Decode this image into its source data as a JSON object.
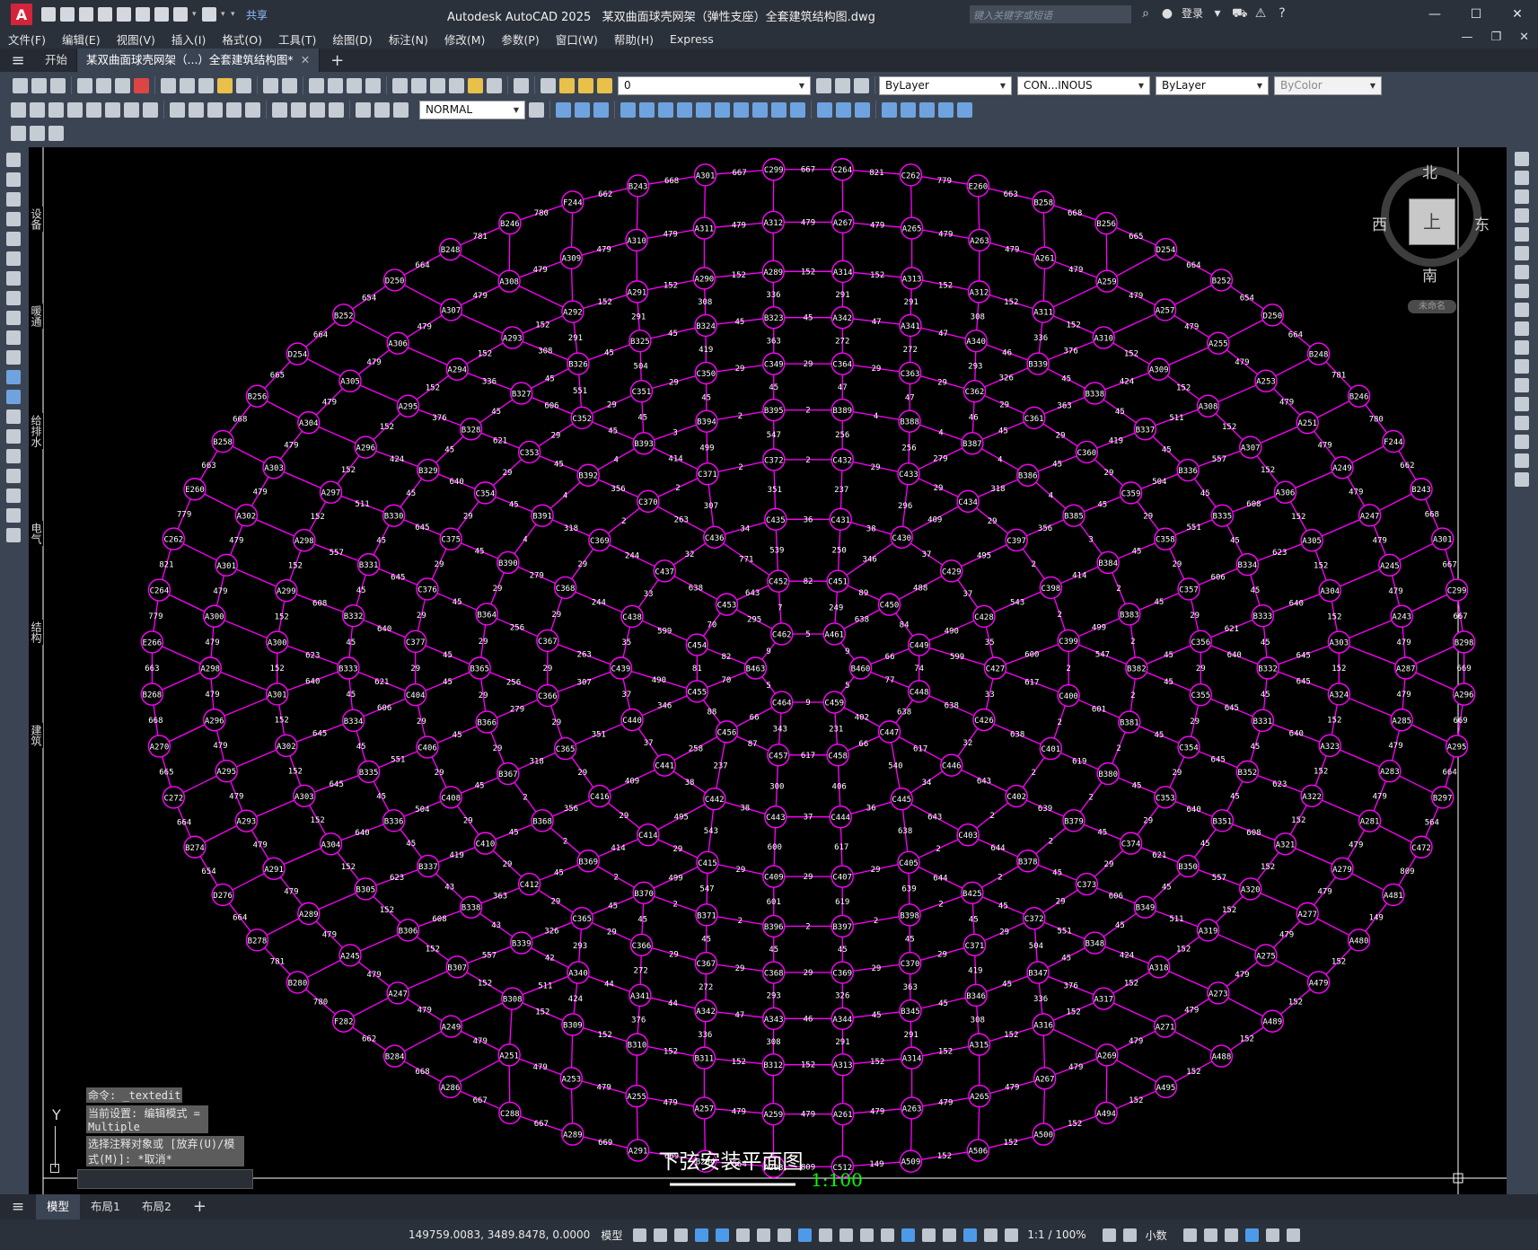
{
  "app": {
    "title": "Autodesk AutoCAD 2025",
    "document": "某双曲面球壳网架（弹性支座）全套建筑结构图.dwg",
    "share": "共享",
    "search_placeholder": "键入关键字或短语",
    "login": "登录"
  },
  "menu": [
    "文件(F)",
    "编辑(E)",
    "视图(V)",
    "插入(I)",
    "格式(O)",
    "工具(T)",
    "绘图(D)",
    "标注(N)",
    "修改(M)",
    "参数(P)",
    "窗口(W)",
    "帮助(H)",
    "Express"
  ],
  "doc_tabs": {
    "start": "开始",
    "active": "某双曲面球壳网架（...）全套建筑结构图*"
  },
  "toolbar": {
    "layer": "0",
    "text_style": "NORMAL",
    "color": "ByLayer",
    "linetype": "CON...INOUS",
    "lineweight": "ByLayer",
    "plotstyle": "ByColor"
  },
  "viewcube": {
    "north": "北",
    "south": "南",
    "east": "东",
    "west": "西",
    "top": "上",
    "wcs": "未命名"
  },
  "side_labels": [
    "设备",
    "暖通",
    "给排水",
    "电气",
    "结构",
    "建筑"
  ],
  "command": {
    "line1": "命令: _textedit",
    "line2": "当前设置: 编辑模式 = Multiple",
    "line3": "选择注释对象或 [放弃(U)/模式(M)]: *取消*"
  },
  "drawing": {
    "title": "下弦安装平面图",
    "scale": "1:100"
  },
  "layout_tabs": [
    "模型",
    "布局1",
    "布局2"
  ],
  "status": {
    "coords": "149759.0083, 3489.8478, 0.0000",
    "space": "模型",
    "annoscale": "1:1 / 100%",
    "units": "小数"
  },
  "colors": {
    "grid_line": "#ff00ff",
    "node_label": "#ffffff",
    "background": "#000000",
    "scale_text": "#00ff00"
  },
  "rings": [
    {
      "id": "ring-1",
      "rx": 80,
      "ry": 60,
      "n": 6,
      "labels": [
        "A461",
        "B460",
        "C459",
        "C464",
        "B463",
        "C462"
      ],
      "seg": [
        "9",
        "5",
        "9",
        "5",
        "9",
        "5"
      ],
      "rad": []
    },
    {
      "id": "ring-2",
      "rx": 175,
      "ry": 137,
      "n": 12,
      "labels": [
        "C451",
        "C450",
        "C449",
        "C448",
        "C447",
        "C458",
        "C457",
        "C456",
        "C455",
        "C454",
        "C453",
        "C452"
      ],
      "seg": [
        "89",
        "84",
        "74",
        "638",
        "66",
        "617",
        "87",
        "88",
        "81",
        "70",
        "643",
        "82"
      ],
      "rad": [
        "249",
        "638",
        "66",
        "77",
        "402",
        "231",
        "343",
        "66",
        "70",
        "82",
        "295",
        "7"
      ]
    },
    {
      "id": "ring-3",
      "rx": 285,
      "ry": 230,
      "n": 18,
      "labels": [
        "C431",
        "C430",
        "C429",
        "C428",
        "C427",
        "C426",
        "C446",
        "C445",
        "C444",
        "C443",
        "C442",
        "C441",
        "C440",
        "C439",
        "C438",
        "C437",
        "C436",
        "C435"
      ],
      "seg": [
        "38",
        "37",
        "37",
        "35",
        "33",
        "32",
        "34",
        "36",
        "37",
        "38",
        "38",
        "37",
        "37",
        "35",
        "33",
        "32",
        "34",
        "36"
      ],
      "rad": [
        "250",
        "346",
        "488",
        "490",
        "599",
        "638",
        "617",
        "540",
        "406",
        "300",
        "237",
        "258",
        "346",
        "490",
        "599",
        "638",
        "771",
        "539"
      ]
    },
    {
      "id": "ring-4",
      "rx": 400,
      "ry": 320,
      "n": 24,
      "labels": [
        "C432",
        "C433",
        "C434",
        "C397",
        "C398",
        "C399",
        "C400",
        "C401",
        "C402",
        "C403",
        "C405",
        "C407",
        "C409",
        "C415",
        "C414",
        "C416",
        "C365",
        "C366",
        "C367",
        "C368",
        "C369",
        "C370",
        "C371",
        "C372"
      ],
      "seg": [
        "29",
        "29",
        "29",
        "2",
        "2",
        "2",
        "2",
        "2",
        "2",
        "2",
        "29",
        "29",
        "29",
        "29",
        "29",
        "29",
        "29",
        "29",
        "29",
        "29",
        "2",
        "2",
        "2",
        "2"
      ],
      "rad": [
        "237",
        "296",
        "409",
        "495",
        "543",
        "600",
        "617",
        "638",
        "643",
        "643",
        "638",
        "617",
        "600",
        "543",
        "495",
        "409",
        "351",
        "307",
        "263",
        "244",
        "244",
        "263",
        "307",
        "351"
      ]
    },
    {
      "id": "ring-5",
      "rx": 500,
      "ry": 395,
      "n": 30,
      "labels": [
        "B389",
        "B388",
        "B387",
        "B386",
        "B385",
        "B384",
        "B383",
        "B382",
        "B381",
        "B380",
        "B379",
        "B378",
        "B425",
        "B398",
        "B397",
        "B396",
        "B371",
        "B370",
        "B369",
        "B368",
        "B367",
        "B366",
        "B365",
        "B364",
        "B390",
        "B391",
        "B392",
        "B393",
        "B394",
        "B395"
      ],
      "seg": [
        "4",
        "4",
        "4",
        "4",
        "3",
        "2",
        "2",
        "2",
        "2",
        "2",
        "2",
        "2",
        "2",
        "2",
        "2",
        "2",
        "2",
        "2",
        "2",
        "2",
        "29",
        "29",
        "29",
        "29",
        "4",
        "4",
        "4",
        "3",
        "2",
        "2"
      ],
      "rad": [
        "256",
        "256",
        "279",
        "318",
        "356",
        "414",
        "499",
        "547",
        "601",
        "619",
        "639",
        "644",
        "644",
        "639",
        "619",
        "601",
        "547",
        "499",
        "414",
        "356",
        "318",
        "279",
        "256",
        "256",
        "279",
        "318",
        "356",
        "414",
        "499",
        "547"
      ]
    },
    {
      "id": "ring-6",
      "rx": 600,
      "ry": 465,
      "n": 36,
      "labels": [
        "C364",
        "C363",
        "C362",
        "C361",
        "C360",
        "C359",
        "C358",
        "C357",
        "C356",
        "C355",
        "C354",
        "C353",
        "C374",
        "C373",
        "C372",
        "C371",
        "C370",
        "C369",
        "C368",
        "C367",
        "C366",
        "C365",
        "C412",
        "C410",
        "C408",
        "C406",
        "C404",
        "C377",
        "C376",
        "C375",
        "C354",
        "C353",
        "C352",
        "C351",
        "C350",
        "C349"
      ],
      "seg": [
        "29",
        "29",
        "29",
        "29",
        "29",
        "29",
        "29",
        "29",
        "29",
        "29",
        "29",
        "29",
        "29",
        "29",
        "29",
        "29",
        "29",
        "29",
        "29",
        "29",
        "29",
        "29",
        "29",
        "29",
        "29",
        "29",
        "29",
        "29",
        "29",
        "29",
        "29",
        "29",
        "29",
        "29",
        "29",
        "29"
      ],
      "rad": [
        "47",
        "47",
        "46",
        "45",
        "45",
        "45",
        "45",
        "45",
        "45",
        "45",
        "45",
        "45",
        "45",
        "45",
        "45",
        "45",
        "45",
        "45",
        "45",
        "45",
        "45",
        "45",
        "45",
        "45",
        "45",
        "45",
        "45",
        "45",
        "45",
        "45",
        "45",
        "45",
        "45",
        "45",
        "45",
        "45"
      ]
    },
    {
      "id": "ring-7",
      "rx": 700,
      "ry": 535,
      "n": 42,
      "labels": [
        "A342",
        "A341",
        "A340",
        "B339",
        "B338",
        "B337",
        "B336",
        "B335",
        "B334",
        "B333",
        "B332",
        "B331",
        "B352",
        "B351",
        "B350",
        "B349",
        "B348",
        "B347",
        "B346",
        "B345",
        "A344",
        "A343",
        "A342",
        "A341",
        "A340",
        "B339",
        "B338",
        "B337",
        "B336",
        "B335",
        "B334",
        "B333",
        "B332",
        "B331",
        "B330",
        "B329",
        "B328",
        "B327",
        "B326",
        "B325",
        "B324",
        "B323"
      ],
      "seg": [
        "47",
        "47",
        "46",
        "45",
        "45",
        "45",
        "45",
        "45",
        "45",
        "45",
        "45",
        "45",
        "45",
        "45",
        "45",
        "45",
        "45",
        "45",
        "45",
        "45",
        "46",
        "47",
        "44",
        "44",
        "42",
        "43",
        "43",
        "45",
        "45",
        "45",
        "45",
        "45",
        "45",
        "45",
        "45",
        "45",
        "45",
        "45",
        "45",
        "45",
        "45",
        "45"
      ],
      "rad": [
        "272",
        "272",
        "293",
        "326",
        "363",
        "419",
        "504",
        "551",
        "606",
        "621",
        "640",
        "645",
        "645",
        "640",
        "621",
        "606",
        "551",
        "504",
        "419",
        "363",
        "326",
        "293",
        "272",
        "272",
        "293",
        "326",
        "363",
        "419",
        "504",
        "551",
        "606",
        "621",
        "640",
        "645",
        "645",
        "640",
        "621",
        "606",
        "551",
        "504",
        "419",
        "363"
      ]
    },
    {
      "id": "ring-8",
      "rx": 810,
      "ry": 605,
      "n": 48,
      "labels": [
        "A314",
        "A313",
        "A312",
        "A311",
        "A310",
        "A309",
        "A308",
        "A307",
        "A306",
        "A305",
        "A304",
        "A303",
        "A324",
        "A323",
        "A322",
        "A321",
        "A320",
        "A319",
        "A318",
        "A317",
        "A316",
        "A315",
        "A314",
        "A313",
        "B312",
        "B311",
        "B310",
        "B309",
        "B308",
        "B307",
        "B306",
        "B305",
        "A304",
        "A303",
        "A302",
        "A301",
        "A300",
        "A299",
        "A298",
        "A297",
        "A296",
        "A295",
        "A294",
        "A293",
        "A292",
        "A291",
        "A290",
        "A289"
      ],
      "seg": [
        "152",
        "152",
        "152",
        "152",
        "152",
        "152",
        "152",
        "152",
        "152",
        "152",
        "152",
        "152",
        "152",
        "152",
        "152",
        "152",
        "152",
        "152",
        "152",
        "152",
        "152",
        "152",
        "152",
        "152",
        "152",
        "152",
        "152",
        "152",
        "152",
        "152",
        "152",
        "152",
        "152",
        "152",
        "152",
        "152",
        "152",
        "152",
        "152",
        "152",
        "152",
        "152",
        "152",
        "152",
        "152",
        "152",
        "152",
        "152"
      ],
      "rad": [
        "291",
        "291",
        "308",
        "336",
        "376",
        "424",
        "511",
        "557",
        "608",
        "623",
        "640",
        "645",
        "645",
        "640",
        "623",
        "608",
        "557",
        "511",
        "424",
        "376",
        "336",
        "308",
        "291",
        "291",
        "308",
        "336",
        "376",
        "424",
        "511",
        "557",
        "608",
        "623",
        "640",
        "645",
        "645",
        "640",
        "623",
        "608",
        "557",
        "511",
        "424",
        "376",
        "336",
        "308",
        "291",
        "291",
        "308",
        "336"
      ]
    },
    {
      "id": "ring-9",
      "rx": 910,
      "ry": 680,
      "n": 54,
      "labels": [
        "A267",
        "A265",
        "A263",
        "A261",
        "A259",
        "A257",
        "A255",
        "A253",
        "A251",
        "A249",
        "A247",
        "A245",
        "A243",
        "A287",
        "A285",
        "A283",
        "A281",
        "A279",
        "A277",
        "A275",
        "A273",
        "A271",
        "A269",
        "A267",
        "A265",
        "A263",
        "A261",
        "A259",
        "A257",
        "A255",
        "A253",
        "A251",
        "A249",
        "A247",
        "A245",
        "A289",
        "A291",
        "A293",
        "A295",
        "A296",
        "A298",
        "A300",
        "A301",
        "A302",
        "A303",
        "A304",
        "A305",
        "A306",
        "A307",
        "A308",
        "A309",
        "A310",
        "A311",
        "A312"
      ],
      "seg": [
        "479",
        "479",
        "479",
        "479",
        "479",
        "479",
        "479",
        "479",
        "479",
        "479",
        "479",
        "479",
        "479",
        "479",
        "479",
        "479",
        "479",
        "479",
        "479",
        "479",
        "479",
        "479",
        "479",
        "479",
        "479",
        "479",
        "479",
        "479",
        "479",
        "479",
        "479",
        "479",
        "479",
        "479",
        "479",
        "479",
        "479",
        "479",
        "479",
        "479",
        "479",
        "479",
        "479",
        "479",
        "479",
        "479",
        "479",
        "479",
        "479",
        "479",
        "479",
        "479",
        "479",
        "479"
      ],
      "rad": []
    },
    {
      "id": "ring-10",
      "rx": 1000,
      "ry": 760,
      "n": 60,
      "labels": [
        "C264",
        "C262",
        "E260",
        "B258",
        "B256",
        "D254",
        "B252",
        "D250",
        "B248",
        "B246",
        "F244",
        "B243",
        "A301",
        "C299",
        "B298",
        "A296",
        "A295",
        "B297",
        "C472",
        "A481",
        "A480",
        "A479",
        "A489",
        "A488",
        "A495",
        "A494",
        "A500",
        "A506",
        "A509",
        "C512",
        "A293",
        "B294",
        "A291",
        "A289",
        "C288",
        "A286",
        "B284",
        "F282",
        "B280",
        "B278",
        "D276",
        "B274",
        "C272",
        "A270",
        "B268",
        "E266",
        "C264",
        "C262",
        "E260",
        "B258",
        "B256",
        "D254",
        "B252",
        "D250",
        "B248",
        "B246",
        "F244",
        "B243",
        "A301",
        "C299"
      ],
      "seg": [
        "821",
        "779",
        "663",
        "668",
        "665",
        "664",
        "654",
        "664",
        "781",
        "780",
        "662",
        "668",
        "667",
        "667",
        "669",
        "669",
        "664",
        "564",
        "809",
        "149",
        "152",
        "152",
        "152",
        "152",
        "152",
        "152",
        "152",
        "152",
        "149",
        "809",
        "564",
        "669",
        "669",
        "667",
        "667",
        "668",
        "662",
        "780",
        "781",
        "664",
        "654",
        "664",
        "665",
        "668",
        "663",
        "779",
        "821",
        "779",
        "663",
        "668",
        "665",
        "664",
        "654",
        "664",
        "781",
        "780",
        "662",
        "668",
        "667",
        "667"
      ],
      "rad": []
    }
  ]
}
